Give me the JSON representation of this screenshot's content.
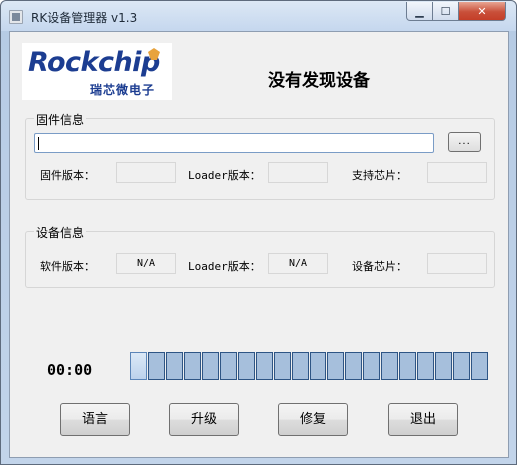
{
  "window": {
    "title": "RK设备管理器 v1.3"
  },
  "logo": {
    "main": "Rockchip",
    "sub": "瑞芯微电子"
  },
  "status": {
    "message": "没有发现设备"
  },
  "firmware": {
    "group_label": "固件信息",
    "path_value": "",
    "browse_label": "...",
    "version_label": "固件版本：",
    "version_value": "",
    "loader_label": "Loader版本：",
    "loader_value": "",
    "chip_label": "支持芯片：",
    "chip_value": ""
  },
  "device": {
    "group_label": "设备信息",
    "software_label": "软件版本：",
    "software_value": "N/A",
    "loader_label": "Loader版本：",
    "loader_value": "N/A",
    "chip_label": "设备芯片：",
    "chip_value": ""
  },
  "progress": {
    "time": "00:00",
    "segments_total": 20,
    "segments_filled": 1
  },
  "buttons": {
    "language": "语言",
    "upgrade": "升级",
    "repair": "修复",
    "exit": "退出"
  },
  "colors": {
    "logo": "#1c3d91",
    "logo_accent": "#e8a33d",
    "progress_segment": "#a6bfdc"
  }
}
